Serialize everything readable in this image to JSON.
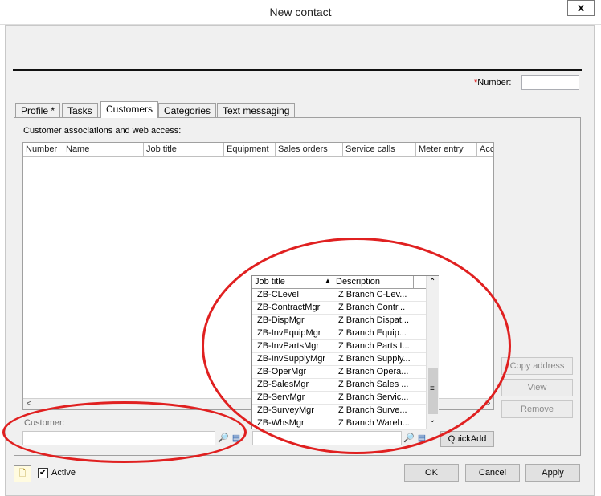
{
  "window": {
    "title": "New contact",
    "close_glyph": "x"
  },
  "header": {
    "number_required": "*",
    "number_label": "Number:",
    "number_value": ""
  },
  "tabs": [
    {
      "label": "Profile *"
    },
    {
      "label": "Tasks"
    },
    {
      "label": "Customers"
    },
    {
      "label": "Categories"
    },
    {
      "label": "Text messaging"
    }
  ],
  "customers_tab": {
    "section_label": "Customer associations and web access:",
    "columns": [
      "Number",
      "Name",
      "Job title",
      "Equipment",
      "Sales orders",
      "Service calls",
      "Meter entry",
      "Acc"
    ],
    "scroll_left": "<",
    "scroll_right": ">",
    "customer_label": "Customer:",
    "customer_value": "",
    "jobtitle_value": "",
    "buttons": {
      "copy_address": "Copy address",
      "view": "View",
      "remove": "Remove",
      "quickadd": "QuickAdd"
    }
  },
  "jobtitle_dropdown": {
    "headers": {
      "job_title": "Job title",
      "description": "Description",
      "sort_glyph": "▲"
    },
    "rows": [
      {
        "job": "ZB-CLevel",
        "desc": "Z Branch C-Lev..."
      },
      {
        "job": "ZB-ContractMgr",
        "desc": "Z Branch Contr..."
      },
      {
        "job": "ZB-DispMgr",
        "desc": "Z Branch Dispat..."
      },
      {
        "job": "ZB-InvEquipMgr",
        "desc": "Z Branch Equip..."
      },
      {
        "job": "ZB-InvPartsMgr",
        "desc": "Z Branch Parts I..."
      },
      {
        "job": "ZB-InvSupplyMgr",
        "desc": "Z Branch Supply..."
      },
      {
        "job": "ZB-OperMgr",
        "desc": "Z Branch Opera..."
      },
      {
        "job": "ZB-SalesMgr",
        "desc": "Z Branch Sales ..."
      },
      {
        "job": "ZB-ServMgr",
        "desc": "Z Branch Servic..."
      },
      {
        "job": "ZB-SurveyMgr",
        "desc": "Z Branch Surve..."
      },
      {
        "job": "ZB-WhsMgr",
        "desc": "Z Branch Wareh..."
      }
    ],
    "scroll_up": "⌃",
    "scroll_down": "⌄",
    "thumb_grip": "≡"
  },
  "footer": {
    "active_label": "Active",
    "active_checked": "✔",
    "ok": "OK",
    "cancel": "Cancel",
    "apply": "Apply"
  },
  "icons": {
    "search": "🔎",
    "lookup": "▤",
    "dropdown": "▾",
    "note": "🗋"
  },
  "colors": {
    "annotation": "#e02020",
    "selected_tab": "#ffffff",
    "panel": "#f0f0f0"
  }
}
